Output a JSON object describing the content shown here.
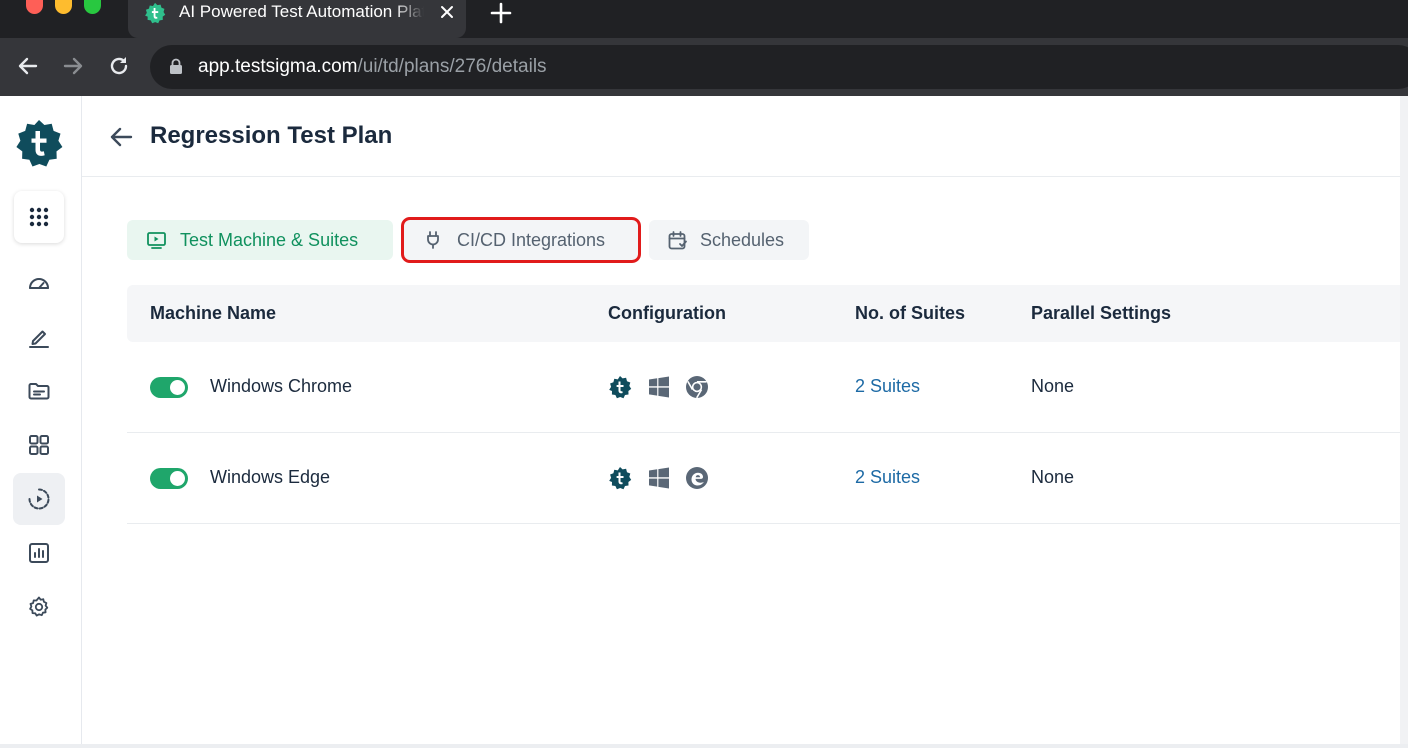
{
  "browser": {
    "tab_title": "AI Powered Test Automation Platform",
    "url_host": "app.testsigma.com",
    "url_path": "/ui/td/plans/276/details"
  },
  "sidebar": {
    "items": [
      {
        "icon": "dashboard-icon"
      },
      {
        "icon": "edit-icon"
      },
      {
        "icon": "folder-icon"
      },
      {
        "icon": "grid-icon"
      },
      {
        "icon": "run-icon",
        "active": true
      },
      {
        "icon": "reports-icon"
      },
      {
        "icon": "settings-icon"
      }
    ]
  },
  "page": {
    "title": "Regression Test Plan"
  },
  "tabs": {
    "machines": "Test Machine & Suites",
    "cicd": "CI/CD Integrations",
    "schedules": "Schedules"
  },
  "table": {
    "headers": {
      "machine_name": "Machine Name",
      "configuration": "Configuration",
      "suites": "No. of Suites",
      "parallel": "Parallel Settings"
    },
    "rows": [
      {
        "enabled": true,
        "name": "Windows Chrome",
        "config_icons": [
          "testsigma-agent-icon",
          "windows-icon",
          "chrome-icon"
        ],
        "suites": "2 Suites",
        "parallel": "None"
      },
      {
        "enabled": true,
        "name": "Windows Edge",
        "config_icons": [
          "testsigma-agent-icon",
          "windows-icon",
          "edge-icon"
        ],
        "suites": "2 Suites",
        "parallel": "None"
      }
    ]
  },
  "colors": {
    "brand": "#0f4c5c",
    "accent_green": "#10915e",
    "link": "#1d6aa5",
    "highlight": "#e11b1b"
  }
}
